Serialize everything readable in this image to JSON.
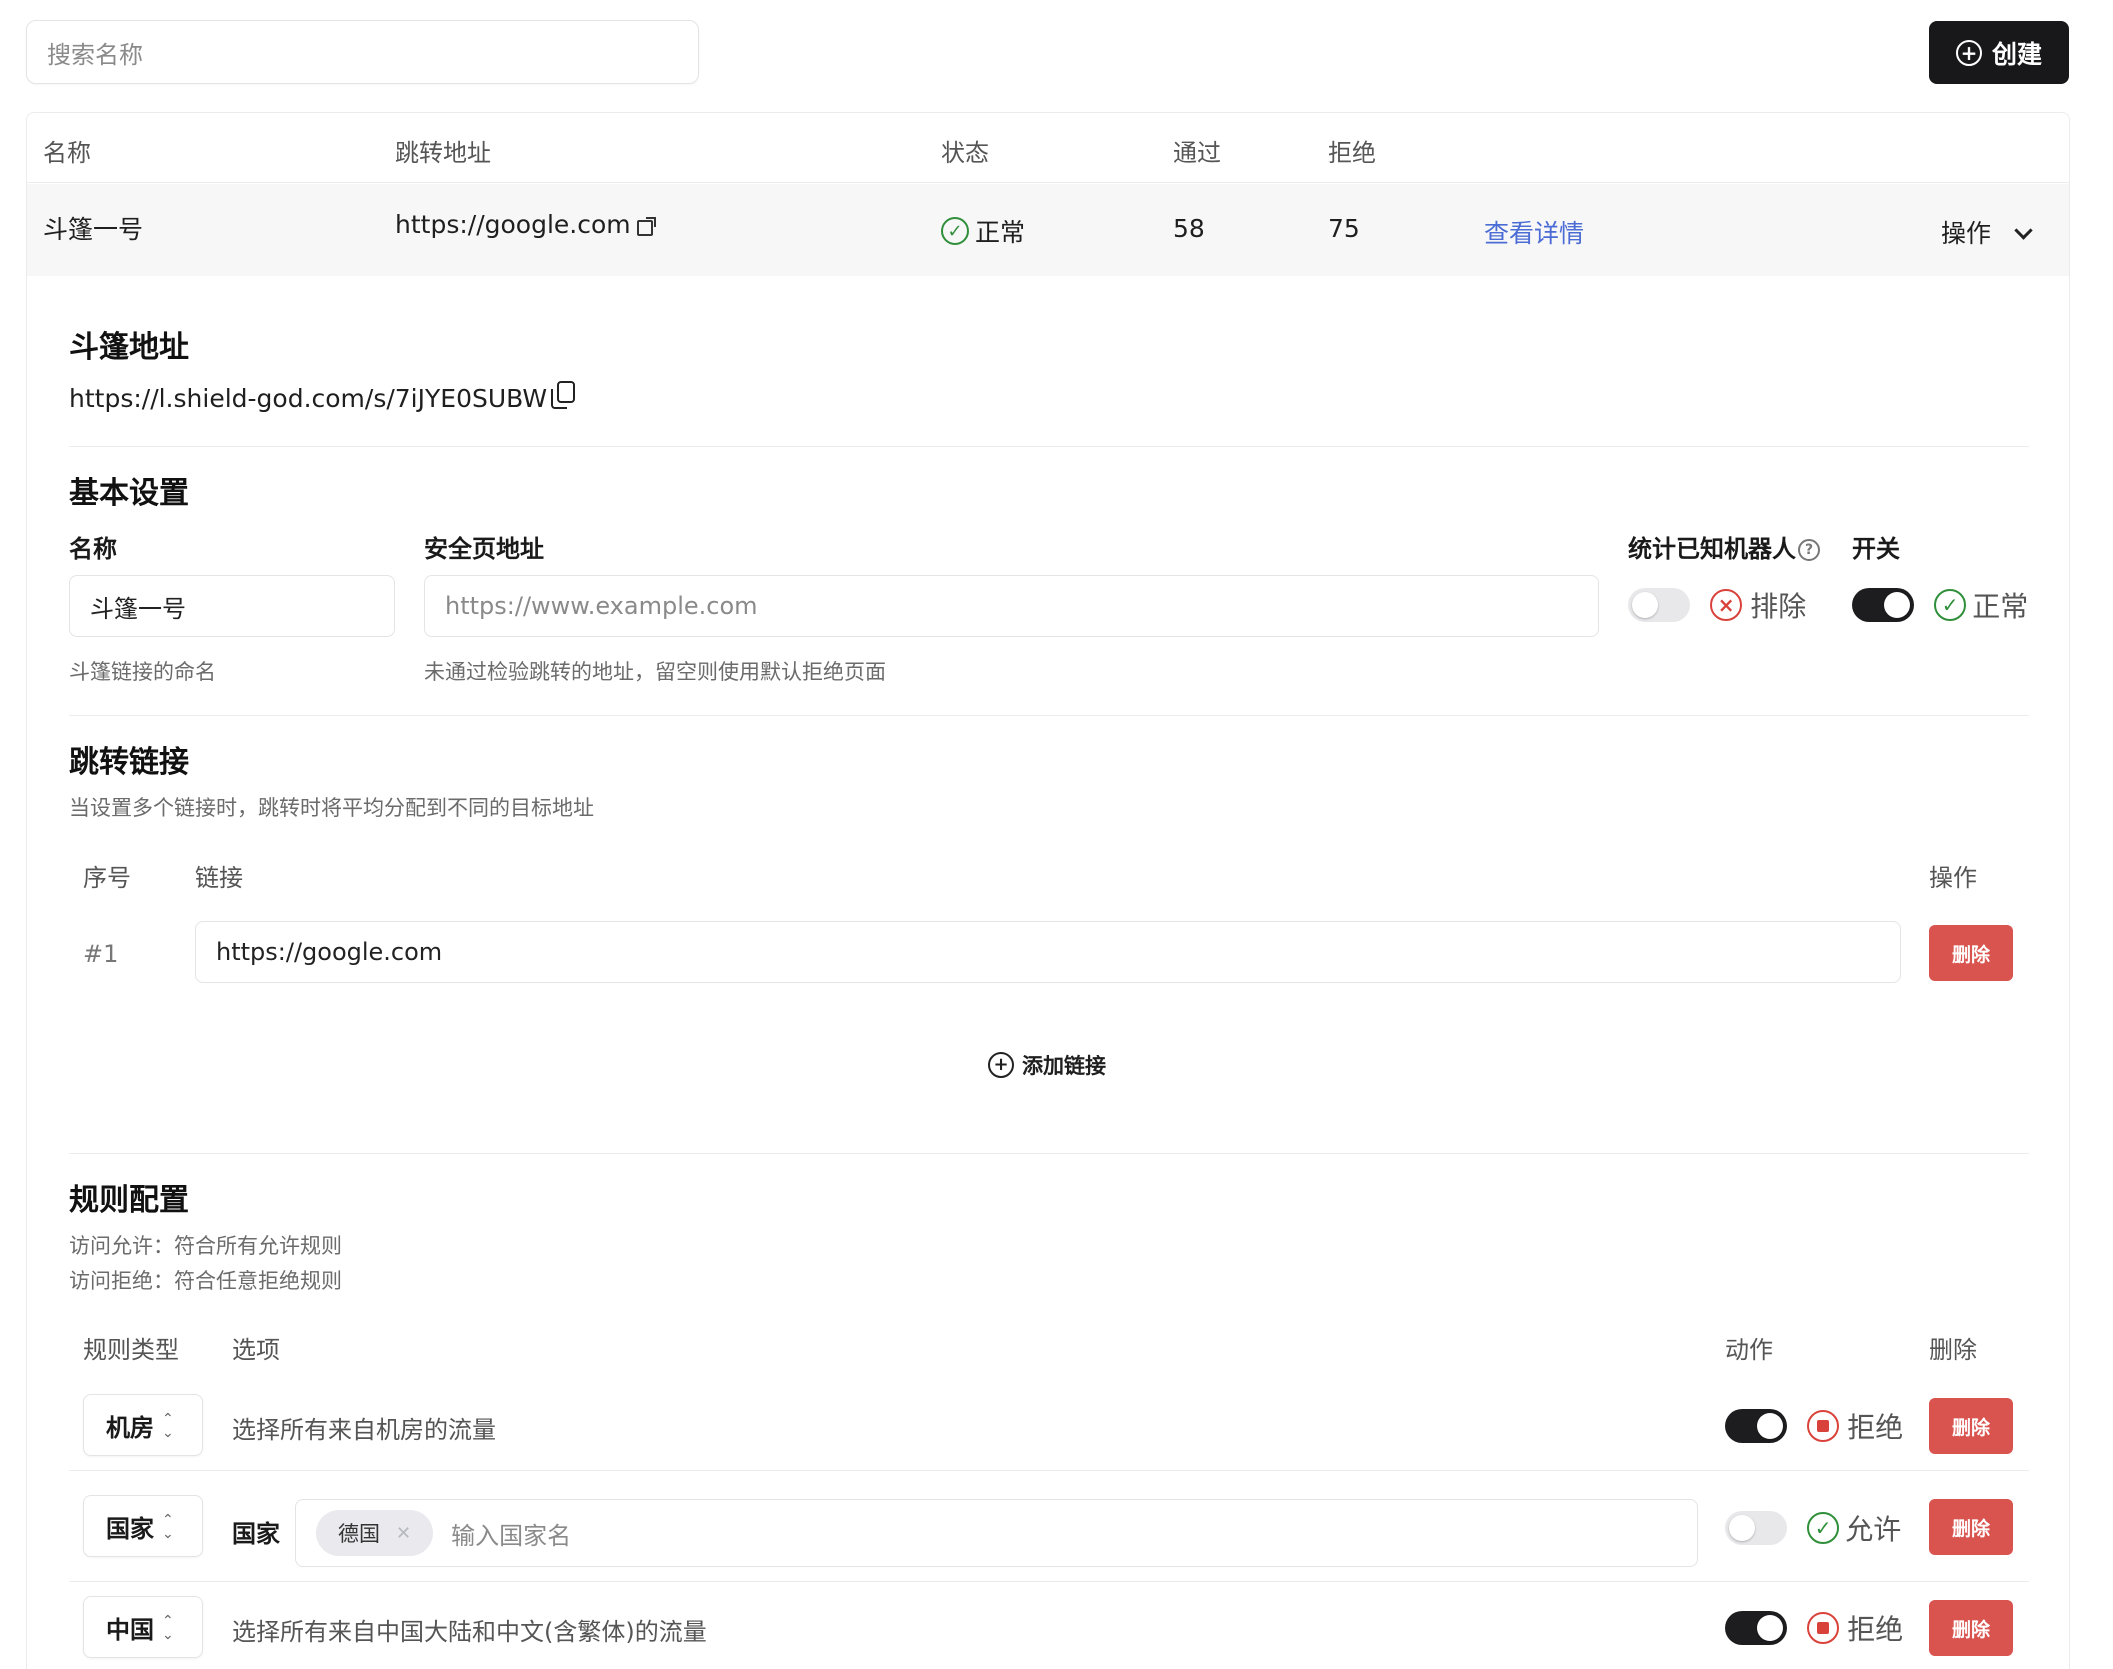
{
  "search": {
    "placeholder": "搜索名称"
  },
  "create_label": "创建",
  "table": {
    "headers": [
      "名称",
      "跳转地址",
      "状态",
      "通过",
      "拒绝"
    ],
    "row": {
      "name": "斗篷一号",
      "url": "https://google.com",
      "status": "正常",
      "pass": "58",
      "reject": "75",
      "detail": "查看详情",
      "action": "操作"
    }
  },
  "cloak": {
    "title": "斗篷地址",
    "url": "https://l.shield-god.com/s/7iJYE0SUBW"
  },
  "basic": {
    "title": "基本设置",
    "name_label": "名称",
    "name_value": "斗篷一号",
    "name_hint": "斗篷链接的命名",
    "safe_label": "安全页地址",
    "safe_placeholder": "https://www.example.com",
    "safe_hint": "未通过检验跳转的地址，留空则使用默认拒绝页面",
    "bots_label": "统计已知机器人",
    "bots_status": "排除",
    "switch_label": "开关",
    "switch_status": "正常"
  },
  "links": {
    "title": "跳转链接",
    "desc": "当设置多个链接时，跳转时将平均分配到不同的目标地址",
    "col_index": "序号",
    "col_link": "链接",
    "col_action": "操作",
    "items": [
      {
        "index": "#1",
        "url": "https://google.com",
        "delete": "删除"
      }
    ],
    "add_label": "添加链接"
  },
  "rules": {
    "title": "规则配置",
    "desc1": "访问允许：符合所有允许规则",
    "desc2": "访问拒绝：符合任意拒绝规则",
    "col_type": "规则类型",
    "col_option": "选项",
    "col_action": "动作",
    "col_delete": "删除",
    "items": [
      {
        "type": "机房",
        "option": "选择所有来自机房的流量",
        "action": "拒绝",
        "delete": "删除"
      },
      {
        "type": "国家",
        "option_label": "国家",
        "chip": "德国",
        "placeholder": "输入国家名",
        "action": "允许",
        "delete": "删除"
      },
      {
        "type": "中国",
        "option": "选择所有来自中国大陆和中文(含繁体)的流量",
        "action": "拒绝",
        "delete": "删除"
      }
    ]
  },
  "colors": {
    "primary": "#18181b",
    "danger": "#d9534f",
    "success": "#2f8f3a",
    "link": "#4a6cd4"
  }
}
